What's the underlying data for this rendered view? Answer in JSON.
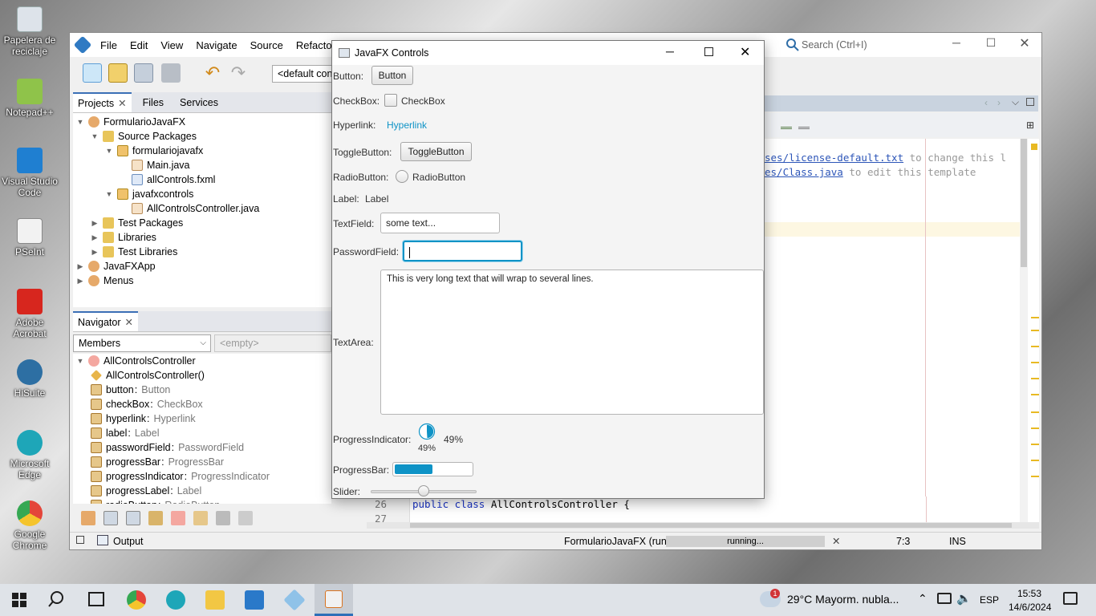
{
  "desktop": {
    "icons": [
      {
        "label": "Papelera de reciclaje",
        "icon": "recycle-bin-icon",
        "color": "#dde3ea"
      },
      {
        "label": "Notepad++",
        "icon": "notepadpp-icon",
        "color": "#8fc34a"
      },
      {
        "label": "Visual Studio Code",
        "icon": "vscode-icon",
        "color": "#1f7fd1"
      },
      {
        "label": "PSeInt",
        "icon": "pseint-icon",
        "color": "#f2f2f2"
      },
      {
        "label": "Adobe Acrobat",
        "icon": "acrobat-icon",
        "color": "#d7261e"
      },
      {
        "label": "HiSuite",
        "icon": "hisuite-icon",
        "color": "#2d6fa3"
      },
      {
        "label": "Microsoft Edge",
        "icon": "edge-icon",
        "color": "#1ea6b8"
      },
      {
        "label": "Google Chrome",
        "icon": "chrome-icon",
        "color": "#e4453a"
      }
    ]
  },
  "netbeans": {
    "menu": [
      "File",
      "Edit",
      "View",
      "Navigate",
      "Source",
      "Refactor"
    ],
    "config_combo": "<default con",
    "search_placeholder": "Search (Ctrl+I)",
    "left_tabs": [
      "Projects",
      "Files",
      "Services"
    ],
    "tree": [
      {
        "label": "FormularioJavaFX",
        "level": 0,
        "toggle": "▼",
        "icon": "project-icon"
      },
      {
        "label": "Source Packages",
        "level": 1,
        "toggle": "▼",
        "icon": "folder-icon"
      },
      {
        "label": "formulariojavafx",
        "level": 2,
        "toggle": "▼",
        "icon": "package-icon"
      },
      {
        "label": "Main.java",
        "level": 3,
        "toggle": "",
        "icon": "java-file-icon"
      },
      {
        "label": "allControls.fxml",
        "level": 3,
        "toggle": "",
        "icon": "fxml-file-icon"
      },
      {
        "label": "javafxcontrols",
        "level": 2,
        "toggle": "▼",
        "icon": "package-icon"
      },
      {
        "label": "AllControlsController.java",
        "level": 3,
        "toggle": "",
        "icon": "java-file-icon"
      },
      {
        "label": "Test Packages",
        "level": 1,
        "toggle": "▶",
        "icon": "folder-icon"
      },
      {
        "label": "Libraries",
        "level": 1,
        "toggle": "▶",
        "icon": "folder-icon"
      },
      {
        "label": "Test Libraries",
        "level": 1,
        "toggle": "▶",
        "icon": "folder-icon"
      },
      {
        "label": "JavaFXApp",
        "level": 0,
        "toggle": "▶",
        "icon": "project-icon"
      },
      {
        "label": "Menus",
        "level": 0,
        "toggle": "▶",
        "icon": "project-icon"
      }
    ],
    "navigator": {
      "tab": "Navigator",
      "members_combo": "Members",
      "empty_combo": "<empty>",
      "root": "AllControlsController",
      "members": [
        {
          "name": "AllControlsController()",
          "type": "",
          "icon": "constructor-icon"
        },
        {
          "name": "button",
          "type": "Button",
          "icon": "field-icon"
        },
        {
          "name": "checkBox",
          "type": "CheckBox",
          "icon": "field-icon"
        },
        {
          "name": "hyperlink",
          "type": "Hyperlink",
          "icon": "field-icon"
        },
        {
          "name": "label",
          "type": "Label",
          "icon": "field-icon"
        },
        {
          "name": "passwordField",
          "type": "PasswordField",
          "icon": "field-icon"
        },
        {
          "name": "progressBar",
          "type": "ProgressBar",
          "icon": "field-icon"
        },
        {
          "name": "progressIndicator",
          "type": "ProgressIndicator",
          "icon": "field-icon"
        },
        {
          "name": "progressLabel",
          "type": "Label",
          "icon": "field-icon"
        },
        {
          "name": "radioButton",
          "type": "RadioButton",
          "icon": "field-icon"
        }
      ]
    },
    "editor": {
      "line1_link": "ses/license-default.txt",
      "line1_rest": " to change this l",
      "line2_link": "es/Class.java",
      "line2_rest": " to edit this template",
      "code_lines": [
        {
          "num": "26",
          "kw": "public class ",
          "rest": "AllControlsController {"
        },
        {
          "num": "27",
          "kw": "",
          "rest": ""
        }
      ]
    },
    "status": {
      "output": "Output",
      "run": "FormularioJavaFX (run)",
      "progress": "running...",
      "position": "7:3",
      "mode": "INS"
    }
  },
  "fx": {
    "title": "JavaFX Controls",
    "button_label": "Button:",
    "button_text": "Button",
    "checkbox_label": "CheckBox:",
    "checkbox_text": "CheckBox",
    "hyperlink_label": "Hyperlink:",
    "hyperlink_text": "Hyperlink",
    "toggle_label": "ToggleButton:",
    "toggle_text": "ToggleButton",
    "radio_label": "RadioButton:",
    "radio_text": "RadioButton",
    "label_label": "Label:",
    "label_text": "Label",
    "textfield_label": "TextField:",
    "textfield_value": "some text...",
    "password_label": "PasswordField:",
    "password_value": "",
    "textarea_label": "TextArea:",
    "textarea_value": "This is very long text that will wrap to several lines.",
    "progressind_label": "ProgressIndicator:",
    "progressind_percent": "49%",
    "progress_label_text": "49%",
    "progress": 0.49,
    "progressbar_label": "ProgressBar:",
    "slider_label": "Slider:",
    "slider_value": 0.5,
    "accent": "#0e93c6"
  },
  "taskbar": {
    "weather": "29°C  Mayorm. nubla...",
    "weather_badge": "1",
    "lang": "ESP",
    "time": "15:53",
    "date": "14/6/2024"
  }
}
